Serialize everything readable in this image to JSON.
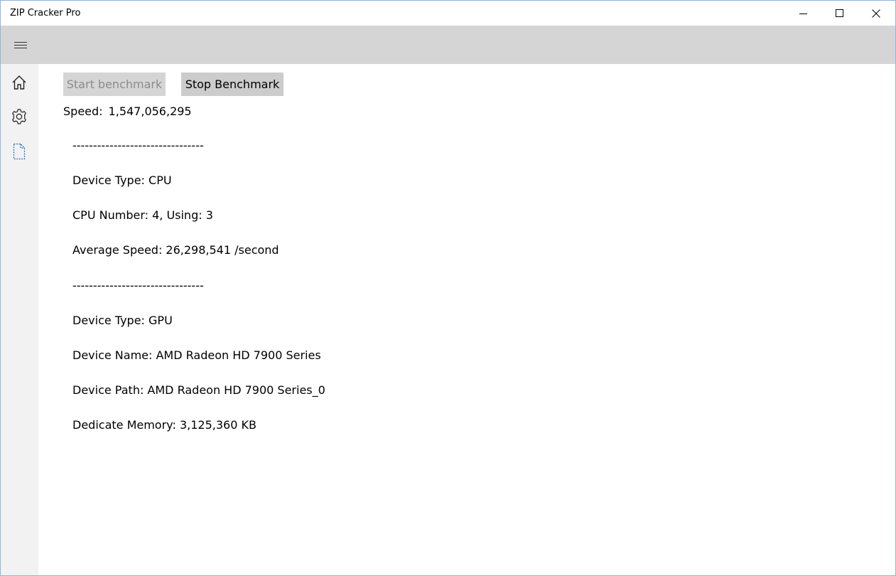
{
  "window": {
    "title": "ZIP Cracker Pro"
  },
  "header": {
    "menu_icon": "hamburger-menu-icon"
  },
  "sidebar": {
    "items": [
      {
        "icon": "home-icon"
      },
      {
        "icon": "gear-icon"
      },
      {
        "icon": "document-icon"
      }
    ]
  },
  "toolbar": {
    "start_label": "Start benchmark",
    "stop_label": "Stop Benchmark"
  },
  "speed": {
    "label": "Speed:",
    "value": "1,547,056,295"
  },
  "results": {
    "lines": [
      "--------------------------------",
      "Device Type: CPU",
      "CPU Number: 4, Using: 3",
      "Average Speed: 26,298,541 /second",
      "--------------------------------",
      "Device Type: GPU",
      "Device Name: AMD Radeon HD 7900 Series",
      "Device Path: AMD Radeon HD 7900 Series_0",
      "Dedicate Memory: 3,125,360 KB"
    ]
  },
  "colors": {
    "header_bg": "#d5d5d5",
    "sidebar_bg": "#f2f2f2",
    "accent": "#1f6fc5"
  }
}
